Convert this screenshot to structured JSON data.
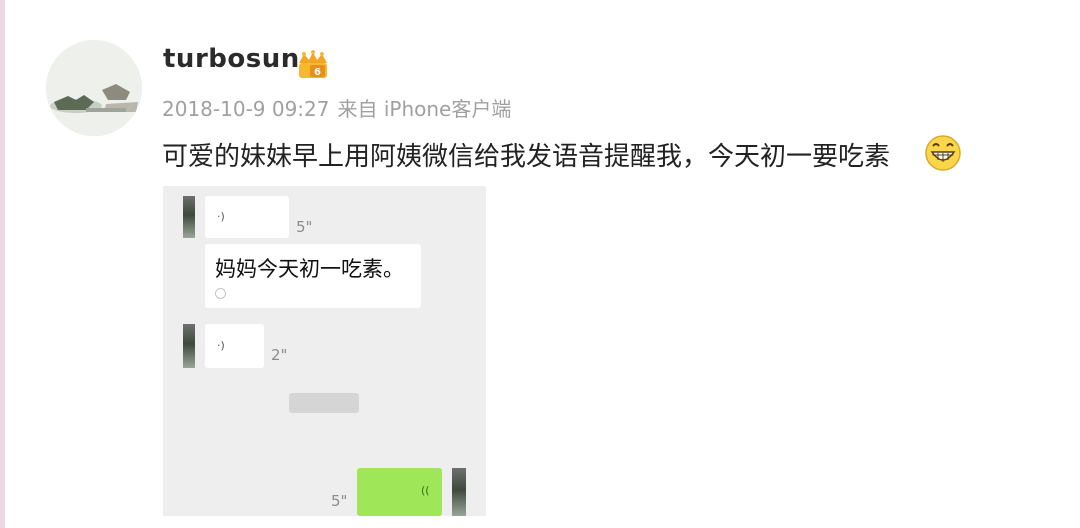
{
  "post": {
    "username": "turbosun",
    "badge_icon": "vip-crown-icon",
    "timestamp": "2018-10-9 09:27",
    "source": "来自 iPhone客户端",
    "text": "可爱的妹妹早上用阿姨微信给我发语音提醒我，今天初一要吃素",
    "emoji_icon": "grinning-emoji-icon"
  },
  "chat": {
    "voice_1_duration": "5\"",
    "text_message": "妈妈今天初一吃素。",
    "text_message_sublabel": "",
    "voice_2_duration": "2\"",
    "system_tip": "",
    "voice_3_duration": "5\"",
    "voice_icon": "((",
    "bubble_color_received": "#ffffff",
    "bubble_color_sent": "#9fe658"
  }
}
